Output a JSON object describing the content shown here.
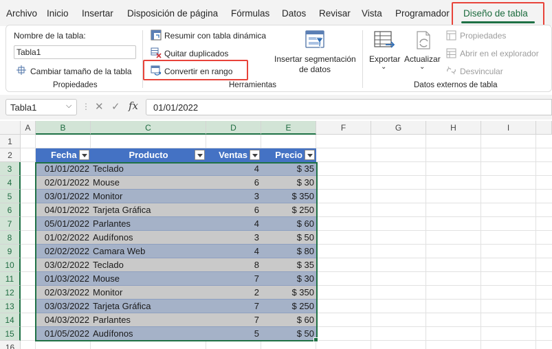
{
  "menu": {
    "tabs": [
      "Archivo",
      "Inicio",
      "Insertar",
      "Disposición de página",
      "Fórmulas",
      "Datos",
      "Revisar",
      "Vista",
      "Programador",
      "Diseño de tabla"
    ],
    "active_tab": "Diseño de tabla"
  },
  "ribbon": {
    "propiedades": {
      "name_label": "Nombre de la tabla:",
      "name_value": "Tabla1",
      "resize_label": "Cambiar tamaño de la tabla",
      "group_label": "Propiedades"
    },
    "herramientas": {
      "pivot_label": "Resumir con tabla dinámica",
      "dedupe_label": "Quitar duplicados",
      "convert_label": "Convertir en rango",
      "slicer_label_1": "Insertar segmentación",
      "slicer_label_2": "de datos",
      "group_label": "Herramientas"
    },
    "externos": {
      "export_label": "Exportar",
      "refresh_label": "Actualizar",
      "props_label": "Propiedades",
      "browser_label": "Abrir en el explorador",
      "unlink_label": "Desvincular",
      "group_label": "Datos externos de tabla"
    }
  },
  "formula_bar": {
    "name_box": "Tabla1",
    "fx": "fx",
    "value": "01/01/2022"
  },
  "sheet": {
    "columns": [
      "A",
      "B",
      "C",
      "D",
      "E",
      "F",
      "G",
      "H",
      "I"
    ],
    "rows": [
      "1",
      "2",
      "3",
      "4",
      "5",
      "6",
      "7",
      "8",
      "9",
      "10",
      "11",
      "12",
      "13",
      "14",
      "15",
      "16"
    ],
    "table_headers": [
      "Fecha",
      "Producto",
      "Ventas",
      "Precio"
    ],
    "table_rows": [
      [
        "01/01/2022",
        "Teclado",
        "4",
        "$ 35"
      ],
      [
        "02/01/2022",
        "Mouse",
        "6",
        "$ 30"
      ],
      [
        "03/01/2022",
        "Monitor",
        "3",
        "$ 350"
      ],
      [
        "04/01/2022",
        "Tarjeta Gráfica",
        "6",
        "$ 250"
      ],
      [
        "05/01/2022",
        "Parlantes",
        "4",
        "$ 60"
      ],
      [
        "01/02/2022",
        "Audífonos",
        "3",
        "$ 50"
      ],
      [
        "02/02/2022",
        "Camara Web",
        "4",
        "$ 80"
      ],
      [
        "03/02/2022",
        "Teclado",
        "8",
        "$ 35"
      ],
      [
        "01/03/2022",
        "Mouse",
        "7",
        "$ 30"
      ],
      [
        "02/03/2022",
        "Monitor",
        "2",
        "$ 350"
      ],
      [
        "03/03/2022",
        "Tarjeta Gráfica",
        "7",
        "$ 250"
      ],
      [
        "04/03/2022",
        "Parlantes",
        "7",
        "$ 60"
      ],
      [
        "01/05/2022",
        "Audífonos",
        "5",
        "$ 50"
      ]
    ]
  },
  "colors": {
    "accent_green": "#1e7145",
    "highlight_red": "#e8433a",
    "table_header_blue": "#4472c4",
    "band_dark": "#a5b2c8",
    "band_light": "#c9c9c9"
  }
}
